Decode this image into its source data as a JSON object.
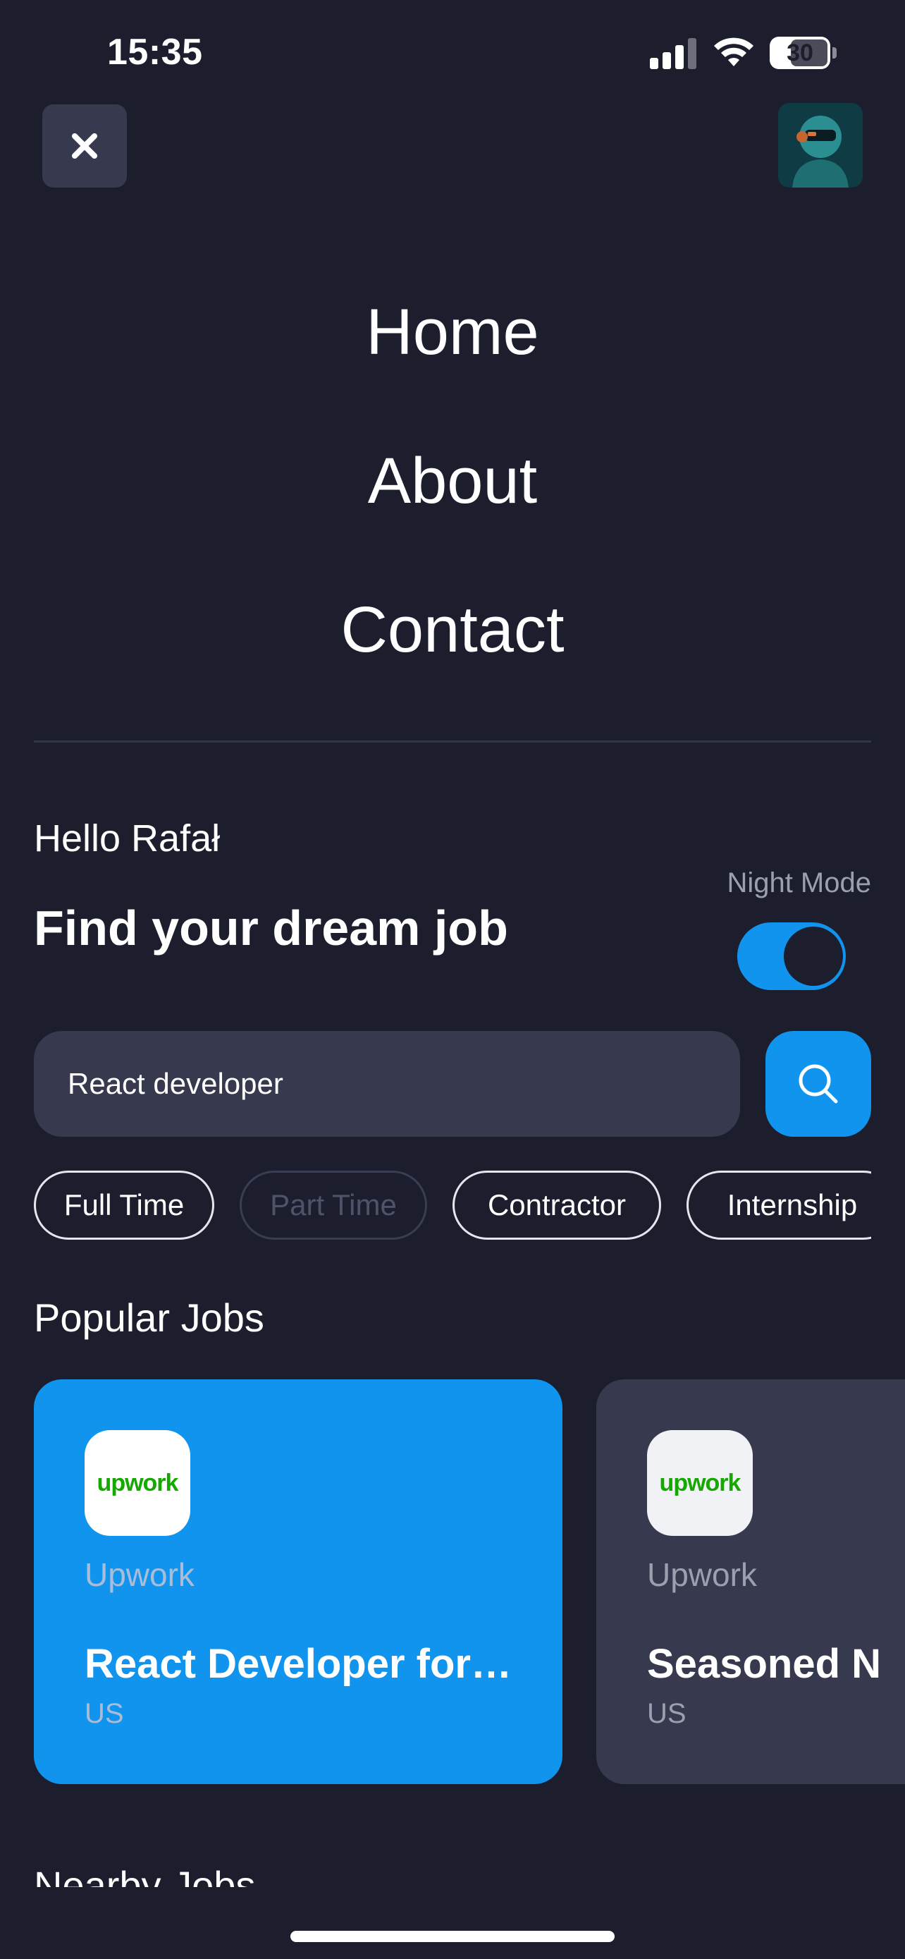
{
  "status_bar": {
    "time": "15:35",
    "battery": "30"
  },
  "header": {
    "close_icon": "close-icon",
    "avatar_icon": "robot-avatar"
  },
  "nav": {
    "items": [
      "Home",
      "About",
      "Contact"
    ]
  },
  "greeting": "Hello Rafał",
  "headline": "Find your dream job",
  "night_mode": {
    "label": "Night Mode",
    "enabled": true
  },
  "search": {
    "value": "React developer",
    "icon": "search-icon"
  },
  "filters": [
    {
      "label": "Full Time",
      "active": true
    },
    {
      "label": "Part Time",
      "active": false
    },
    {
      "label": "Contractor",
      "active": true
    },
    {
      "label": "Internship",
      "active": true
    }
  ],
  "popular": {
    "title": "Popular Jobs",
    "jobs": [
      {
        "logo_text": "upwork",
        "company": "Upwork",
        "title": "React Developer for…",
        "location": "US"
      },
      {
        "logo_text": "upwork",
        "company": "Upwork",
        "title": "Seasoned N",
        "location": "US"
      }
    ]
  },
  "nearby": {
    "title": "Nearby Jobs"
  },
  "colors": {
    "background": "#1c1e2d",
    "accent": "#1194ed",
    "card": "#373a4f",
    "upwork_green": "#14a800"
  }
}
